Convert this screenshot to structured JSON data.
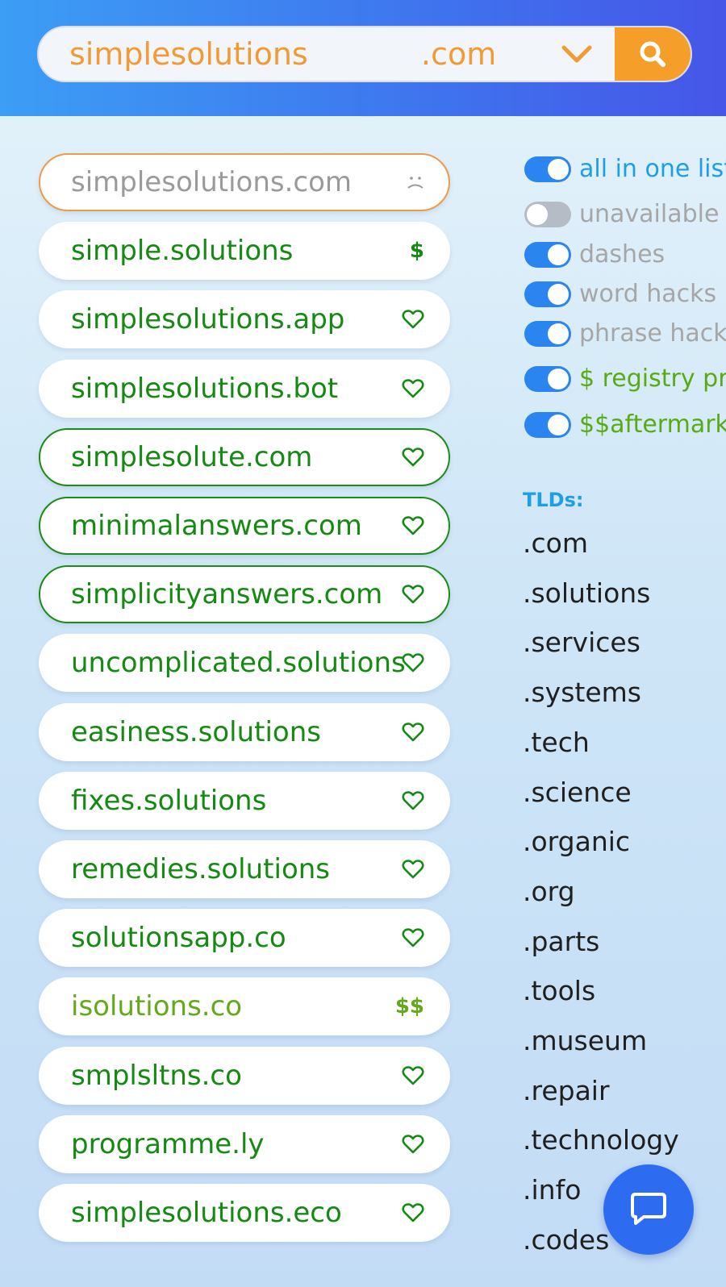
{
  "search": {
    "term": "simplesolutions",
    "tld": ".com"
  },
  "results": [
    {
      "name": "simplesolutions.com",
      "status": "taken",
      "icon": "sad-face-icon"
    },
    {
      "name": "simple.solutions",
      "status": "premium",
      "mark": "$"
    },
    {
      "name": "simplesolutions.app",
      "status": "available",
      "icon": "heart-icon"
    },
    {
      "name": "simplesolutions.bot",
      "status": "available",
      "icon": "heart-icon"
    },
    {
      "name": "simplesolute.com",
      "status": "available-highlighted",
      "icon": "heart-icon"
    },
    {
      "name": "minimalanswers.com",
      "status": "available-highlighted",
      "icon": "heart-icon"
    },
    {
      "name": "simplicityanswers.com",
      "status": "available-highlighted",
      "icon": "heart-icon"
    },
    {
      "name": "uncomplicated.solutions",
      "status": "available",
      "icon": "heart-icon"
    },
    {
      "name": "easiness.solutions",
      "status": "available",
      "icon": "heart-icon"
    },
    {
      "name": "fixes.solutions",
      "status": "available",
      "icon": "heart-icon"
    },
    {
      "name": "remedies.solutions",
      "status": "available",
      "icon": "heart-icon"
    },
    {
      "name": "solutionsapp.co",
      "status": "available",
      "icon": "heart-icon"
    },
    {
      "name": "isolutions.co",
      "status": "aftermarket",
      "mark": "$$"
    },
    {
      "name": "smplsltns.co",
      "status": "available",
      "icon": "heart-icon"
    },
    {
      "name": "programme.ly",
      "status": "available",
      "icon": "heart-icon"
    },
    {
      "name": "simplesolutions.eco",
      "status": "available",
      "icon": "heart-icon"
    }
  ],
  "filters": [
    {
      "label": "all in one list",
      "on": true,
      "color": "#1f9fe3"
    },
    {
      "label": "unavailable",
      "on": false,
      "color": "#a6a6a6"
    },
    {
      "label": "dashes",
      "on": true,
      "color": "#a6a6a6"
    },
    {
      "label": "word hacks",
      "on": true,
      "color": "#a6a6a6"
    },
    {
      "label": "phrase hacks",
      "on": true,
      "color": "#a6a6a6"
    },
    {
      "label": "$ registry pre",
      "on": true,
      "color": "#5aaa14"
    },
    {
      "label": "$$aftermarke",
      "on": true,
      "color": "#5aaa14"
    }
  ],
  "tlds": {
    "heading": "TLDs:",
    "items": [
      ".com",
      ".solutions",
      ".services",
      ".systems",
      ".tech",
      ".science",
      ".organic",
      ".org",
      ".parts",
      ".tools",
      ".museum",
      ".repair",
      ".technology",
      ".info",
      ".codes"
    ]
  },
  "colors": {
    "header": "#3f73ee",
    "accent_orange": "#f59e2a",
    "available_green": "#148a12",
    "aftermarket_green": "#62aa1a",
    "toggle_blue": "#2a85f0",
    "chat_blue": "#2d6cf0"
  }
}
